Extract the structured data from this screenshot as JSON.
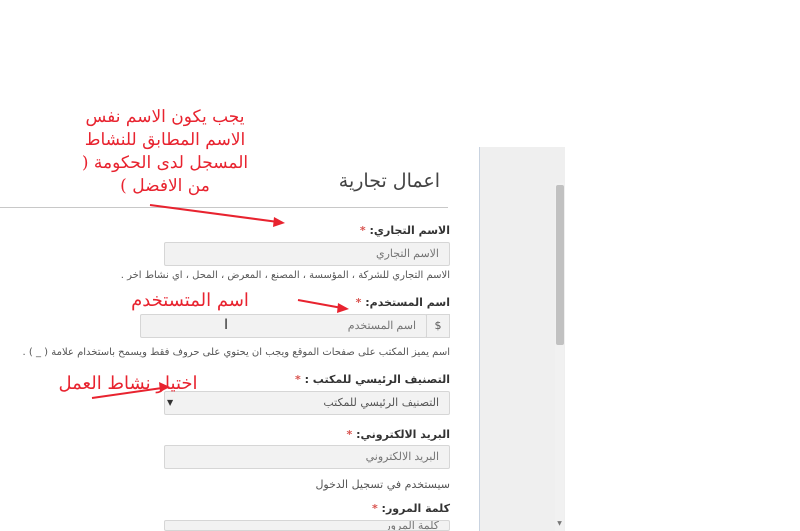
{
  "form": {
    "section_title": "اعمال تجارية",
    "business_name": {
      "label": "الاسم التجاري:",
      "required_mark": "*",
      "placeholder": "الاسم التجاري",
      "help": "الاسم التجاري للشركة ، المؤسسة ، المصنع ، المعرض ، المحل ، اي نشاط اخر ."
    },
    "username": {
      "label": "اسم المستخدم:",
      "required_mark": "*",
      "addon": "$",
      "placeholder": "اسم المستخدم",
      "help": "اسم يميز المكتب على صفحات الموقع ويجب ان يحتوي على حروف فقط ويسمح باستخدام علامة ( _ ) ."
    },
    "category": {
      "label": "التصنيف الرئيسي للمكتب :",
      "required_mark": "*",
      "selected": "التصنيف الرئيسي للمكتب"
    },
    "email": {
      "label": "البريد الالكتروني:",
      "required_mark": "*",
      "placeholder": "البريد الالكتروني",
      "help": "سيستخدم في تسجيل الدخول"
    },
    "password": {
      "label": "كلمة المرور:",
      "required_mark": "*",
      "placeholder": "كلمة المرور"
    }
  },
  "annotations": {
    "note_business_name": [
      "يجب يكون الاسم نفس",
      "الاسم المطابق للنشاط",
      "المسجل لدى الحكومة (",
      "من الافضل )"
    ],
    "note_username": "اسم المتستخدم",
    "note_activity": "اختيار نشاط العمل",
    "color": "#e8232f"
  },
  "colors": {
    "required": "#d9534f",
    "input_bg": "#f2f2f2",
    "side_panel_border": "#c9d3e0"
  },
  "icons": {
    "cursor": "text-cursor-icon",
    "select_caret": "caret-down-icon",
    "scroll_arrow": "scroll-down-arrow-icon",
    "arrows": "annotation-arrow-icon"
  }
}
